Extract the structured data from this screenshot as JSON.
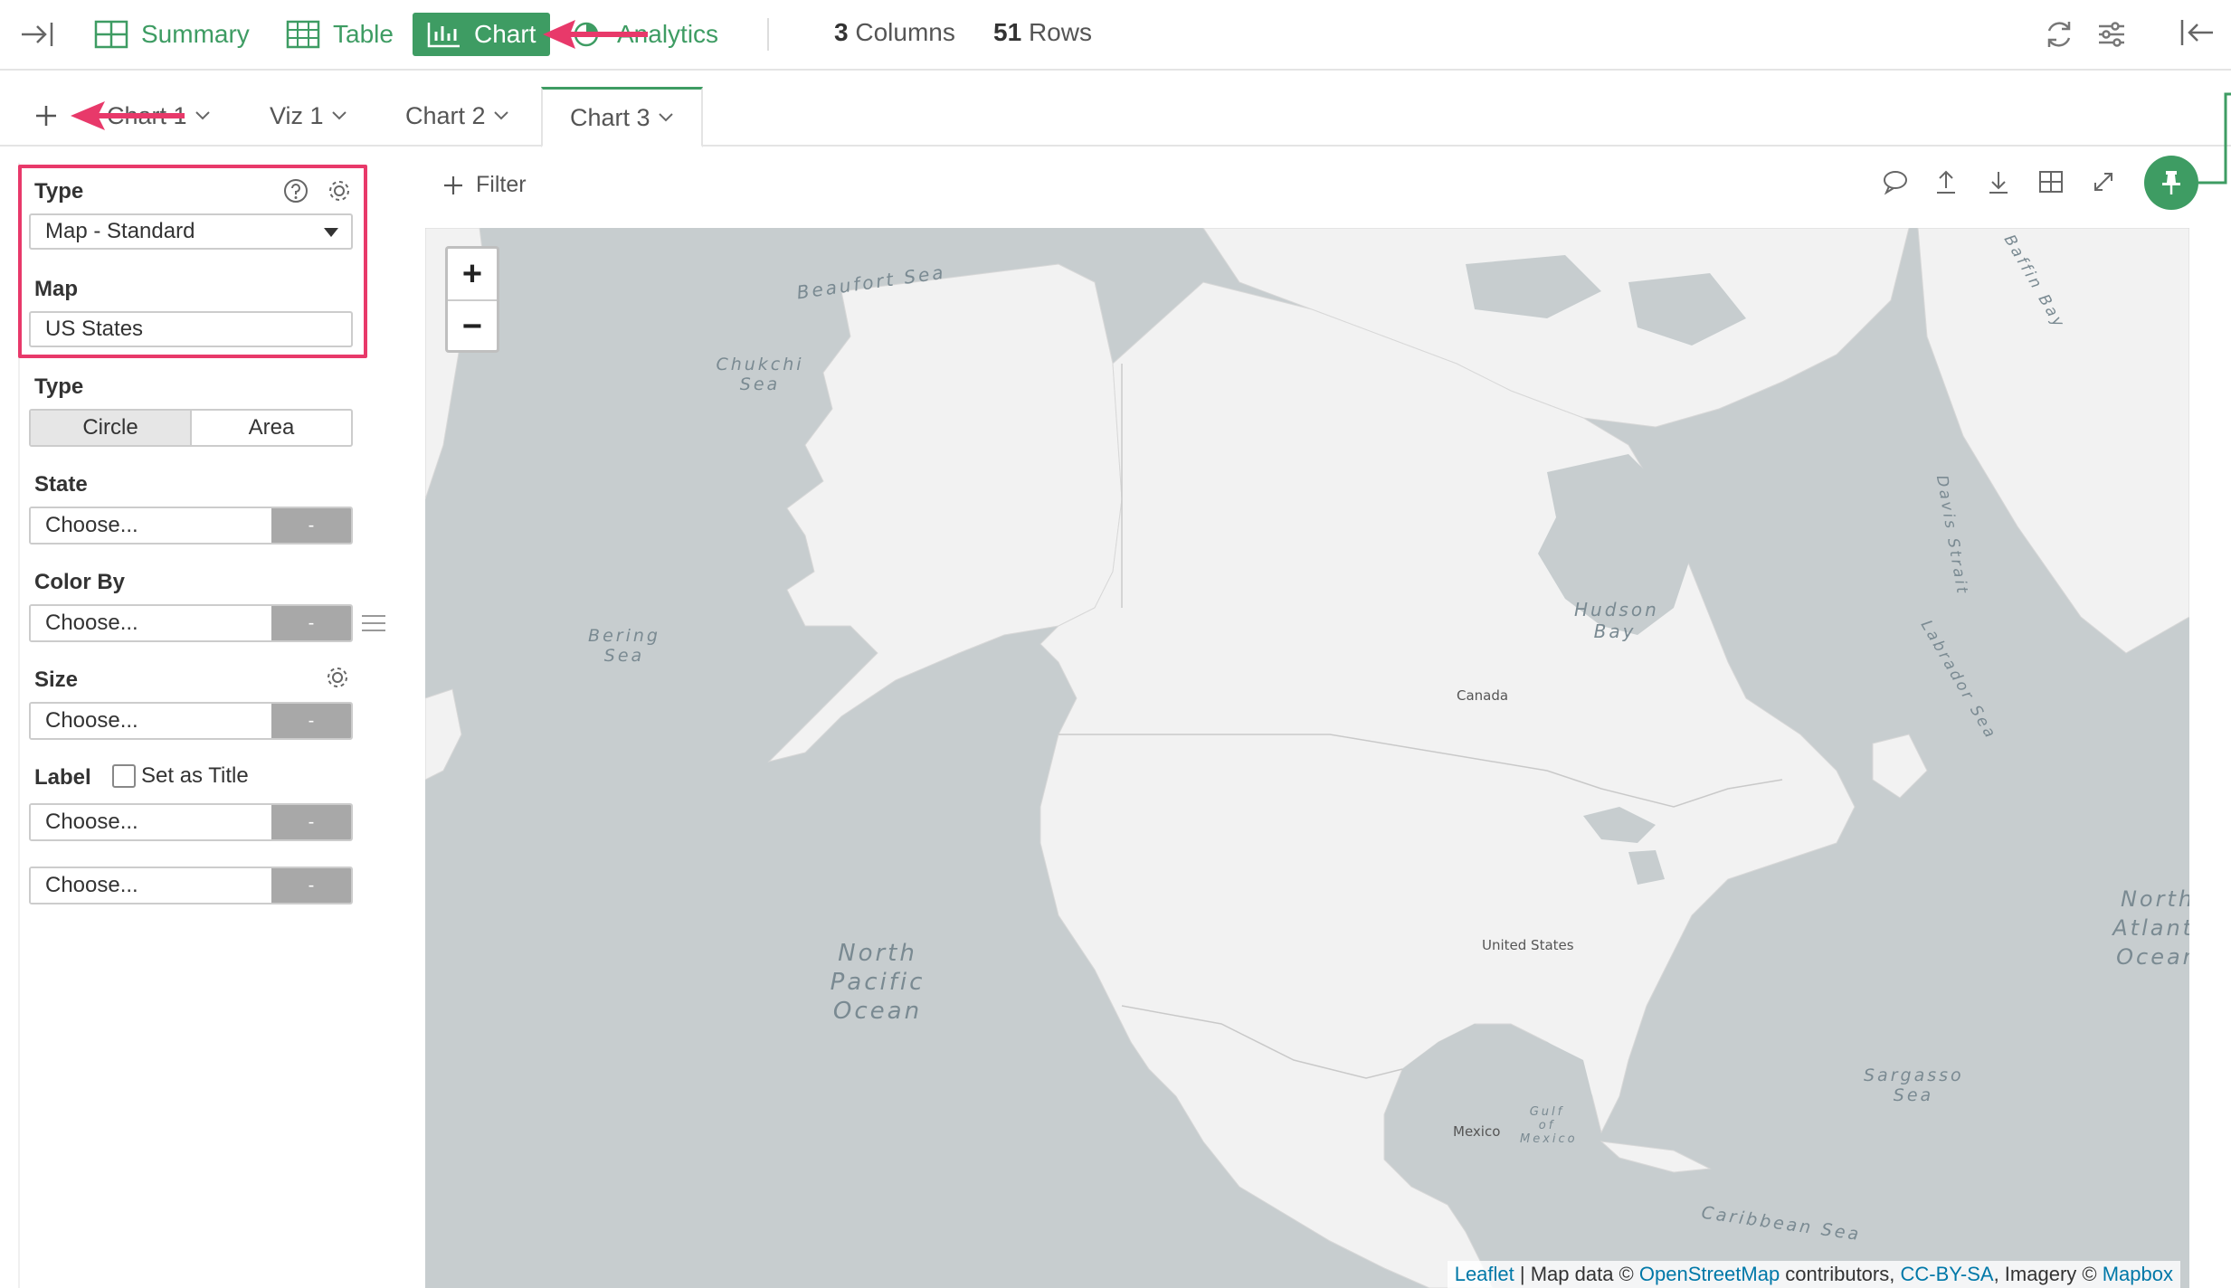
{
  "topbar": {
    "summary": "Summary",
    "table": "Table",
    "chart": "Chart",
    "analytics": "Analytics",
    "columns_count": "3",
    "columns_label": "Columns",
    "rows_count": "51",
    "rows_label": "Rows"
  },
  "tabs": [
    {
      "label": "Chart 1"
    },
    {
      "label": "Viz 1"
    },
    {
      "label": "Chart 2"
    },
    {
      "label": "Chart 3"
    }
  ],
  "sidebar": {
    "type_label": "Type",
    "type_value": "Map - Standard",
    "map_label": "Map",
    "map_value": "US States",
    "subtype_label": "Type",
    "subtype_options": [
      "Circle",
      "Area"
    ],
    "subtype_selected": "Circle",
    "state_label": "State",
    "color_label": "Color By",
    "size_label": "Size",
    "label_label": "Label",
    "set_as_title": "Set as Title",
    "choose": "Choose...",
    "dash": "-"
  },
  "toolbar": {
    "filter": "Filter"
  },
  "map": {
    "zoom_in": "+",
    "zoom_out": "−",
    "attribution": {
      "leaflet": "Leaflet",
      "map_data": " | Map data © ",
      "osm": "OpenStreetMap",
      "contributors": " contributors, ",
      "license": "CC-BY-SA",
      "imagery": ", Imagery © ",
      "mapbox": "Mapbox"
    },
    "labels": {
      "beaufort": "Beaufort Sea",
      "chukchi": "Chukchi Sea",
      "bering": "Bering Sea",
      "hudson": "Hudson Bay",
      "north_pacific": "North Pacific Ocean",
      "north_atlantic": "North Atlanti Ocean",
      "sargasso": "Sargasso Sea",
      "caribbean": "Caribbean Sea",
      "canada": "Canada",
      "us": "United States",
      "mexico": "Mexico",
      "davis": "Davis Strait",
      "labrador": "Labrador Sea",
      "baffin": "Baffin Bay",
      "gulf": "Gulf of Mexico"
    }
  },
  "colors": {
    "accent": "#3e9c63",
    "highlight": "#e8396a",
    "water": "#c7cdcf",
    "land": "#f2f2f2"
  }
}
